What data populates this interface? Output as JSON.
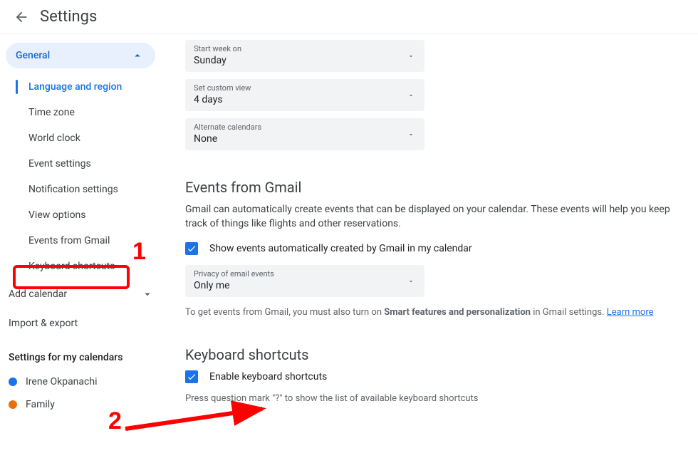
{
  "header": {
    "title": "Settings"
  },
  "sidebar": {
    "general_label": "General",
    "items": [
      "Language and region",
      "Time zone",
      "World clock",
      "Event settings",
      "Notification settings",
      "View options",
      "Events from Gmail",
      "Keyboard shortcuts"
    ],
    "add_calendar": "Add calendar",
    "import_export": "Import & export",
    "my_calendars_heading": "Settings for my calendars",
    "calendars": [
      {
        "name": "Irene Okpanachi",
        "color": "#1a73e8"
      },
      {
        "name": "Family",
        "color": "#e8710a"
      }
    ]
  },
  "dropdowns": {
    "start_week": {
      "label": "Start week on",
      "value": "Sunday"
    },
    "custom_view": {
      "label": "Set custom view",
      "value": "4 days"
    },
    "alt_cal": {
      "label": "Alternate calendars",
      "value": "None"
    },
    "privacy": {
      "label": "Privacy of email events",
      "value": "Only me"
    }
  },
  "gmail": {
    "title": "Events from Gmail",
    "desc": "Gmail can automatically create events that can be displayed on your calendar. These events will help you keep track of things like flights and other reservations.",
    "checkbox_label": "Show events automatically created by Gmail in my calendar",
    "hint_pre": "To get events from Gmail, you must also turn on ",
    "hint_bold": "Smart features and personalization",
    "hint_post": " in Gmail settings. ",
    "hint_link": "Learn more"
  },
  "kbd": {
    "title": "Keyboard shortcuts",
    "checkbox_label": "Enable keyboard shortcuts",
    "hint": "Press question mark \"?\" to show the list of available keyboard shortcuts"
  },
  "callouts": {
    "c1": "1",
    "c2": "2"
  }
}
